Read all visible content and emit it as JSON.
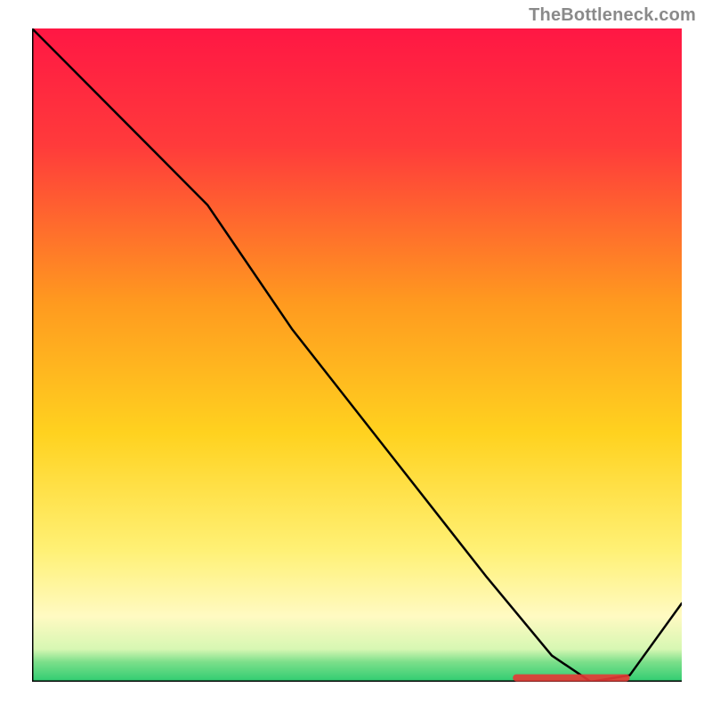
{
  "watermark": "TheBottleneck.com",
  "colors": {
    "curve": "#000000",
    "marker": "#e53935",
    "axis": "#000000"
  },
  "chart_data": {
    "type": "line",
    "title": "",
    "xlabel": "",
    "ylabel": "",
    "xlim": [
      0,
      100
    ],
    "ylim": [
      0,
      100
    ],
    "x": [
      0,
      10,
      20,
      27,
      40,
      55,
      70,
      80,
      86,
      92,
      100
    ],
    "values": [
      100,
      90,
      80,
      73,
      54,
      35,
      16,
      4,
      0,
      1,
      12
    ],
    "marker_range_x": [
      74,
      92
    ],
    "marker_y": 0.6,
    "gradient_stops": [
      {
        "pos": 0.0,
        "color": "#ff1744"
      },
      {
        "pos": 0.18,
        "color": "#ff3b3b"
      },
      {
        "pos": 0.42,
        "color": "#ff9a1f"
      },
      {
        "pos": 0.62,
        "color": "#ffd21f"
      },
      {
        "pos": 0.8,
        "color": "#fff176"
      },
      {
        "pos": 0.9,
        "color": "#fffac2"
      },
      {
        "pos": 0.95,
        "color": "#d7f7b3"
      },
      {
        "pos": 0.97,
        "color": "#7bdf8a"
      },
      {
        "pos": 1.0,
        "color": "#2ecc71"
      }
    ]
  }
}
